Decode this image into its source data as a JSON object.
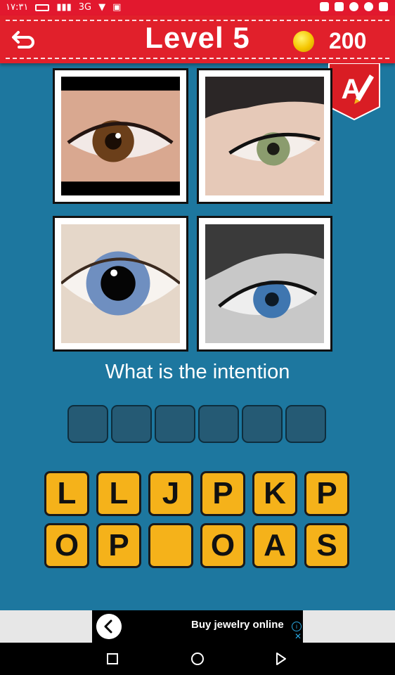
{
  "status_bar": {
    "time": "١٧:٣١",
    "network": "3G"
  },
  "header": {
    "level_label": "Level 5",
    "coins": "200"
  },
  "puzzle": {
    "question": "What is the intention",
    "answer_slots": [
      "",
      "",
      "",
      "",
      "",
      ""
    ],
    "images": [
      "brown-eye-photo",
      "green-eye-eyeliner-photo",
      "blue-eye-closeup-photo",
      "blue-eye-black-and-white-photo"
    ]
  },
  "keyboard": {
    "row1": [
      "L",
      "L",
      "J",
      "P",
      "K",
      "P"
    ],
    "row2": [
      "O",
      "P",
      "",
      "O",
      "A",
      "S"
    ]
  },
  "ad": {
    "text": "Buy jewelry online"
  },
  "colors": {
    "background": "#1d779f",
    "header": "#e1202b",
    "key_fill": "#f5b21a",
    "slot_fill": "#255a74"
  }
}
